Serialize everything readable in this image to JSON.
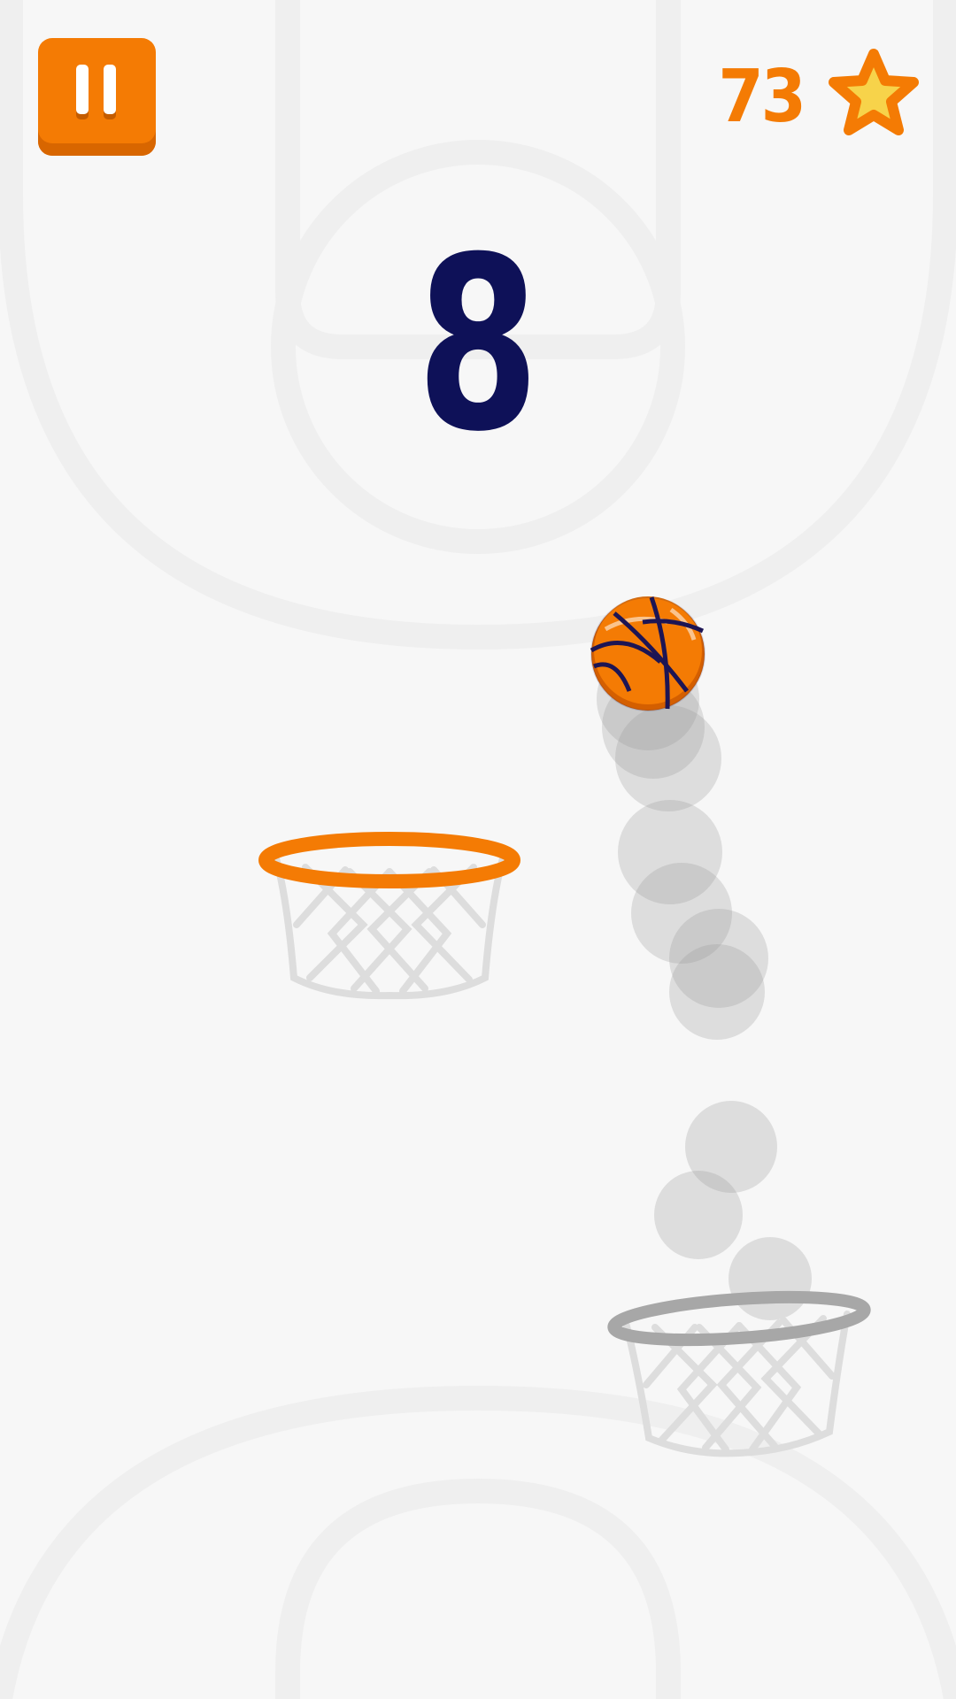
{
  "hud": {
    "pause_icon": "pause-icon",
    "star_count": "73",
    "star_icon": "star-icon",
    "score": "8"
  },
  "colors": {
    "background": "#f7f7f7",
    "court_lines": "#efefef",
    "accent_orange": "#f47b04",
    "score_navy": "#0e1158",
    "star_yellow": "#f7d34a",
    "inactive_rim": "#a7a7a7",
    "net": "#dddddd",
    "trail": "#cfcfcf"
  },
  "game": {
    "active_hoop": "left",
    "ball_icon": "basketball-icon"
  }
}
